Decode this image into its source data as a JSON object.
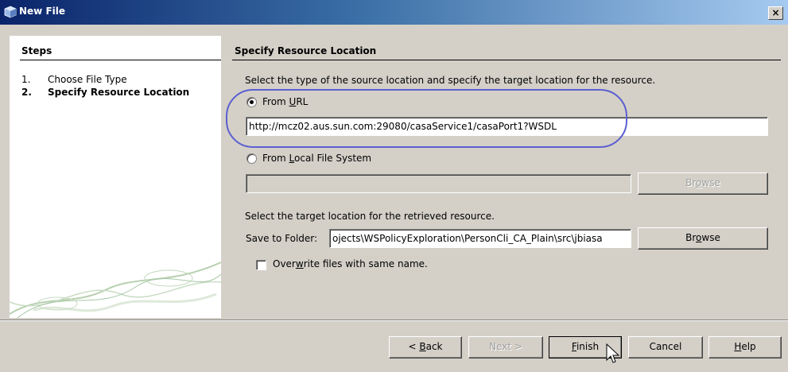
{
  "window": {
    "title": "New File",
    "close_glyph": "×"
  },
  "steps": {
    "title": "Steps",
    "items": [
      {
        "num": "1.",
        "label": "Choose File Type"
      },
      {
        "num": "2.",
        "label": "Specify Resource Location"
      }
    ]
  },
  "content": {
    "title": "Specify Resource Location",
    "instruction": "Select the type of the source location and specify the target location for the resource.",
    "from_url": {
      "label_pre": "From ",
      "label_mnemonic": "U",
      "label_post": "RL",
      "selected": true,
      "value": "http://mcz02.aus.sun.com:29080/casaService1/casaPort1?WSDL"
    },
    "from_local": {
      "label_pre": "From ",
      "label_mnemonic": "L",
      "label_post": "ocal File System",
      "selected": false,
      "value": "",
      "browse_pre": "Br",
      "browse_mnemonic": "o",
      "browse_post": "wse"
    },
    "target_instruction": "Select the target location for the retrieved resource.",
    "save_to_folder": {
      "label": "Save to Folder:",
      "value": "ojects\\WSPolicyExploration\\PersonCli_CA_Plain\\src\\jbiasa",
      "browse_pre": "Br",
      "browse_mnemonic": "o",
      "browse_post": "wse"
    },
    "overwrite": {
      "label_pre": "Over",
      "label_mnemonic": "w",
      "label_post": "rite files with same name.",
      "checked": false
    }
  },
  "footer": {
    "back": {
      "pre": "< ",
      "mnemonic": "B",
      "post": "ack"
    },
    "next": {
      "label": "Next >"
    },
    "finish": {
      "pre": "",
      "mnemonic": "F",
      "post": "inish"
    },
    "cancel": {
      "label": "Cancel"
    },
    "help": {
      "pre": "",
      "mnemonic": "H",
      "post": "elp"
    }
  },
  "colors": {
    "title_gradient_start": "#0a246a",
    "title_gradient_end": "#a6caf0",
    "dialog_bg": "#d4d0c8",
    "annotation_oval": "#5b5fd0"
  }
}
